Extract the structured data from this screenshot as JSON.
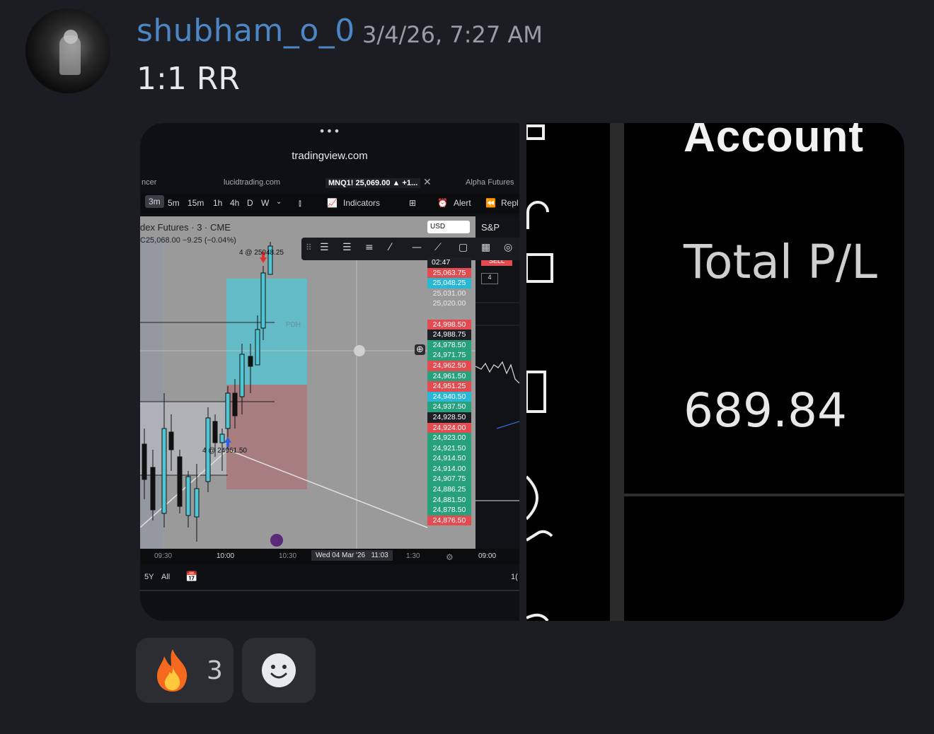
{
  "message": {
    "username": "shubham_o_0",
    "timestamp": "3/4/26, 7:27 AM",
    "text": "1:1 RR"
  },
  "left_image": {
    "dots": "•••",
    "url": "tradingview.com",
    "tabs": [
      "ncer",
      "lucidtrading.com",
      "MNQ1! 25,069.00 ▲ +1...",
      "Alpha Futures"
    ],
    "timeframes": [
      "3m",
      "5m",
      "15m",
      "1h",
      "4h",
      "D",
      "W"
    ],
    "selected_timeframe": "3m",
    "toolbar": {
      "indicators": "Indicators",
      "alert": "Alert",
      "replay": "Repl"
    },
    "chart_title": "dex Futures · 3 · CME",
    "chart_sub": "C25,068.00 −9.25 (−0.04%)",
    "currency": "USD",
    "right_symbol": "S&P",
    "sell_label": "SELL",
    "qty_label": "4",
    "labels": {
      "top_fill": "4 @ 25048.25",
      "bottom_fill": "4 @ 24961.50",
      "poh": "PDH"
    },
    "price_time": "02:47",
    "prices": [
      {
        "v": "25,063.75",
        "c": "#e24b4f"
      },
      {
        "v": "25,048.25",
        "c": "#29b7d4"
      },
      {
        "v": "25,031.00",
        "c": "transparent"
      },
      {
        "v": "25,020.00",
        "c": "transparent"
      },
      {
        "v": "",
        "c": "transparent"
      },
      {
        "v": "24,998.50",
        "c": "#e24b4f"
      },
      {
        "v": "24,988.75",
        "c": "#1d1f24"
      },
      {
        "v": "24,978.50",
        "c": "#26a17c"
      },
      {
        "v": "24,971.75",
        "c": "#26a17c"
      },
      {
        "v": "24,962.50",
        "c": "#e24b4f"
      },
      {
        "v": "24,961.50",
        "c": "#26a17c"
      },
      {
        "v": "24,951.25",
        "c": "#e24b4f"
      },
      {
        "v": "24,940.50",
        "c": "#29b7d4"
      },
      {
        "v": "24,937.50",
        "c": "#26a17c"
      },
      {
        "v": "24,928.50",
        "c": "#1d1f24"
      },
      {
        "v": "24,924.00",
        "c": "#e24b4f"
      },
      {
        "v": "24,923.00",
        "c": "#26a17c"
      },
      {
        "v": "24,921.50",
        "c": "#26a17c"
      },
      {
        "v": "24,914.50",
        "c": "#26a17c"
      },
      {
        "v": "24,914.00",
        "c": "#26a17c"
      },
      {
        "v": "24,907.75",
        "c": "#26a17c"
      },
      {
        "v": "24,886.25",
        "c": "#26a17c"
      },
      {
        "v": "24,881.50",
        "c": "#26a17c"
      },
      {
        "v": "24,878.50",
        "c": "#26a17c"
      },
      {
        "v": "24,876.50",
        "c": "#e24b4f"
      }
    ],
    "time_axis": {
      "t1": "09:30",
      "t2": "10:00",
      "t3": "10:30",
      "date": "Wed 04 Mar '26",
      "time": "11:03",
      "t4": "1:30",
      "t5": "09:00"
    },
    "bottom": {
      "range1": "5Y",
      "range2": "All",
      "right": "1("
    }
  },
  "right_image": {
    "account_text": "Account",
    "total_pl_label": "Total P/L",
    "total_pl_value": "689.84"
  },
  "reactions": [
    {
      "emoji": "🔥",
      "count": "3"
    },
    {
      "emoji": "add-reaction"
    }
  ]
}
